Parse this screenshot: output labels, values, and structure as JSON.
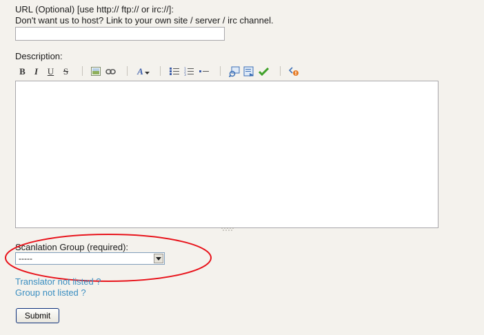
{
  "url_section": {
    "label_line1": "URL (Optional) [use http:// ftp:// or irc://]:",
    "label_line2": "Don't want us to host? Link to your own site / server / irc channel.",
    "value": ""
  },
  "description": {
    "label": "Description:",
    "toolbar": [
      {
        "name": "bold",
        "icon": "bold-icon",
        "glyph": "B"
      },
      {
        "name": "italic",
        "icon": "italic-icon",
        "glyph": "I"
      },
      {
        "name": "underline",
        "icon": "underline-icon",
        "glyph": "U"
      },
      {
        "name": "strikethrough",
        "icon": "strikethrough-icon",
        "glyph": "S"
      },
      {
        "name": "insert-image",
        "icon": "image-icon"
      },
      {
        "name": "insert-link",
        "icon": "link-icon"
      },
      {
        "name": "font-style",
        "icon": "font-style-icon",
        "glyph": "A"
      },
      {
        "name": "unordered-list",
        "icon": "bullet-list-icon"
      },
      {
        "name": "ordered-list",
        "icon": "numbered-list-icon"
      },
      {
        "name": "horizontal-rule",
        "icon": "horizontal-rule-icon"
      },
      {
        "name": "preview",
        "icon": "preview-icon"
      },
      {
        "name": "source",
        "icon": "source-icon"
      },
      {
        "name": "spellcheck",
        "icon": "check-icon"
      },
      {
        "name": "help",
        "icon": "help-icon"
      }
    ],
    "value": ""
  },
  "group": {
    "label": "Scanlation Group (required):",
    "selected": "-----",
    "highlight_color": "#e8131b"
  },
  "links": {
    "translator": "Translator not listed ?",
    "group": "Group not listed ?"
  },
  "submit_label": "Submit",
  "colors": {
    "background": "#f4f2ed",
    "link": "#3a8ec1",
    "button_border": "#0c2f7a"
  }
}
